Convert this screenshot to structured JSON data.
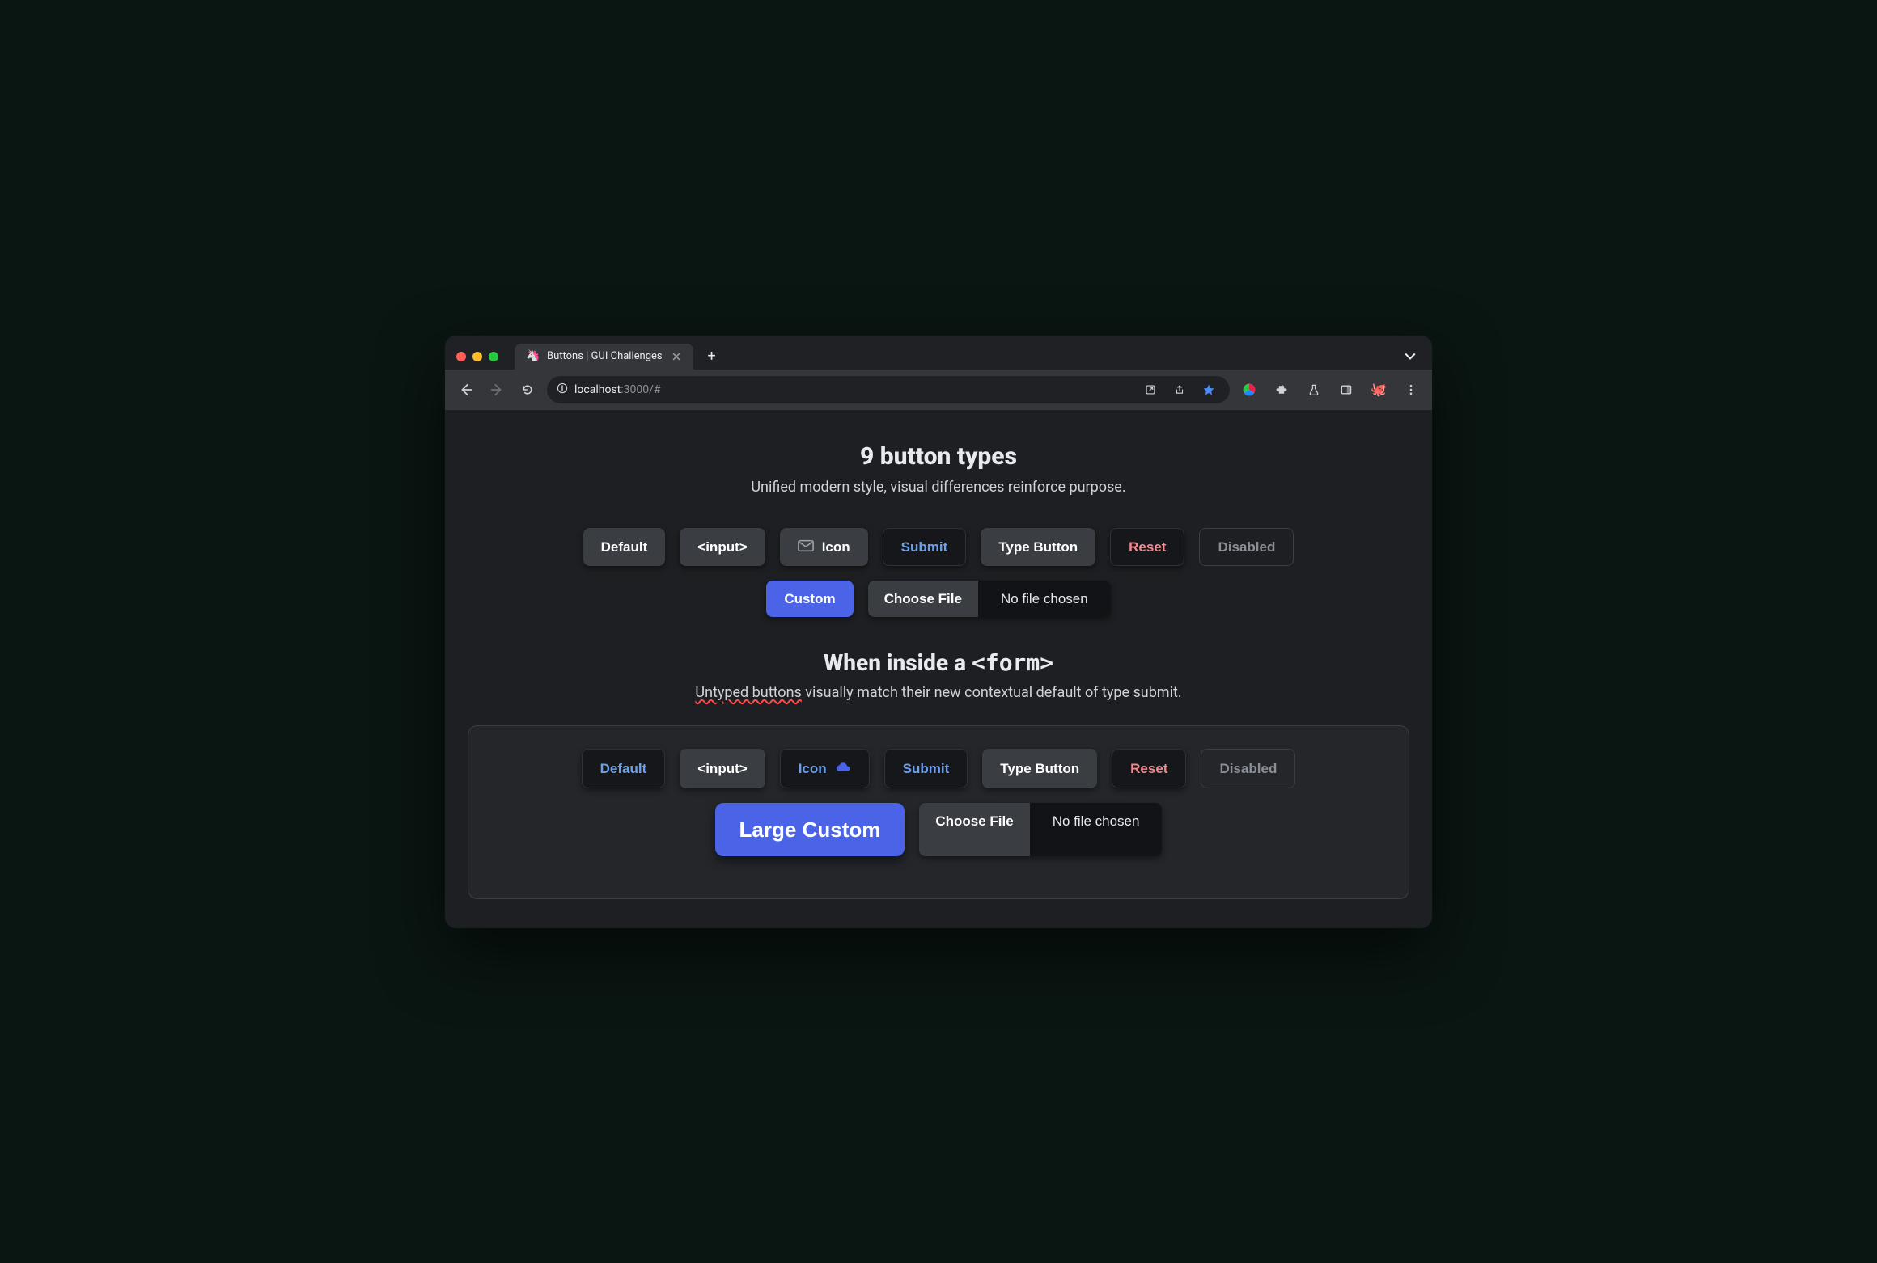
{
  "browser": {
    "tab_title": "Buttons | GUI Challenges",
    "url_host": "localhost",
    "url_port": ":3000",
    "url_path": "/#"
  },
  "section1": {
    "title": "9 button types",
    "subtitle": "Unified modern style, visual differences reinforce purpose.",
    "buttons": {
      "default": "Default",
      "input": "<input>",
      "icon": "Icon",
      "submit": "Submit",
      "type_button": "Type Button",
      "reset": "Reset",
      "disabled": "Disabled",
      "custom": "Custom",
      "choose_file": "Choose File",
      "no_file": "No file chosen"
    }
  },
  "section2": {
    "title_prefix": "When inside a ",
    "title_code": "<form>",
    "subtitle_highlight": "Untyped buttons",
    "subtitle_rest": " visually match their new contextual default of type submit.",
    "buttons": {
      "default": "Default",
      "input": "<input>",
      "icon": "Icon",
      "submit": "Submit",
      "type_button": "Type Button",
      "reset": "Reset",
      "disabled": "Disabled",
      "custom": "Large Custom",
      "choose_file": "Choose File",
      "no_file": "No file chosen"
    }
  }
}
